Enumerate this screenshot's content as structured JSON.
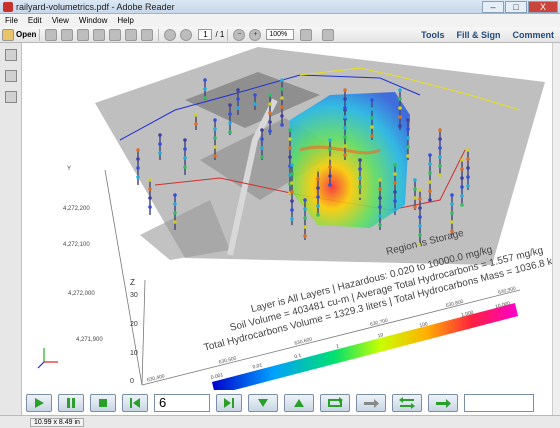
{
  "window": {
    "title": "railyard-volumetrics.pdf - Adobe Reader",
    "minimize": "–",
    "maximize": "□",
    "close": "X"
  },
  "menu": [
    "File",
    "Edit",
    "View",
    "Window",
    "Help"
  ],
  "toolbar": {
    "open_label": "Open",
    "page_current": "1",
    "page_total": "/ 1",
    "zoom": "100%",
    "tools": "Tools",
    "fill_sign": "Fill & Sign",
    "comment": "Comment"
  },
  "scene": {
    "region_line": "Region is Storage",
    "layer_line": "Layer is All Layers  |  Hazardous: 0.020 to 10000.0 mg/kg",
    "soil_line": "Soil Volume = 403481 cu-m  |  Average Total Hydrocarbons = 1.557 mg/kg",
    "hydro_line": "Total Hydrocarbons Volume = 1329.3 liters  |  Total Hydrocarbons Mass = 1036.8 kg",
    "y_ticks": [
      "4,272,200",
      "4,272,100",
      "4,272,000",
      "4,271,900"
    ],
    "z_label": "Z",
    "z_ticks": [
      "30",
      "20",
      "10",
      "0"
    ],
    "x_ticks": [
      "630,400",
      "630,500",
      "630,600",
      "630,700",
      "630,800",
      "630,900"
    ],
    "y_axis_label": "Y",
    "legend_ticks": [
      "0.001",
      "0.01",
      "0.1",
      "1",
      "10",
      "100",
      "1,000",
      "10,000"
    ]
  },
  "player": {
    "frame": "6"
  },
  "status": {
    "dimensions": "10.99 x 8.49 in"
  }
}
